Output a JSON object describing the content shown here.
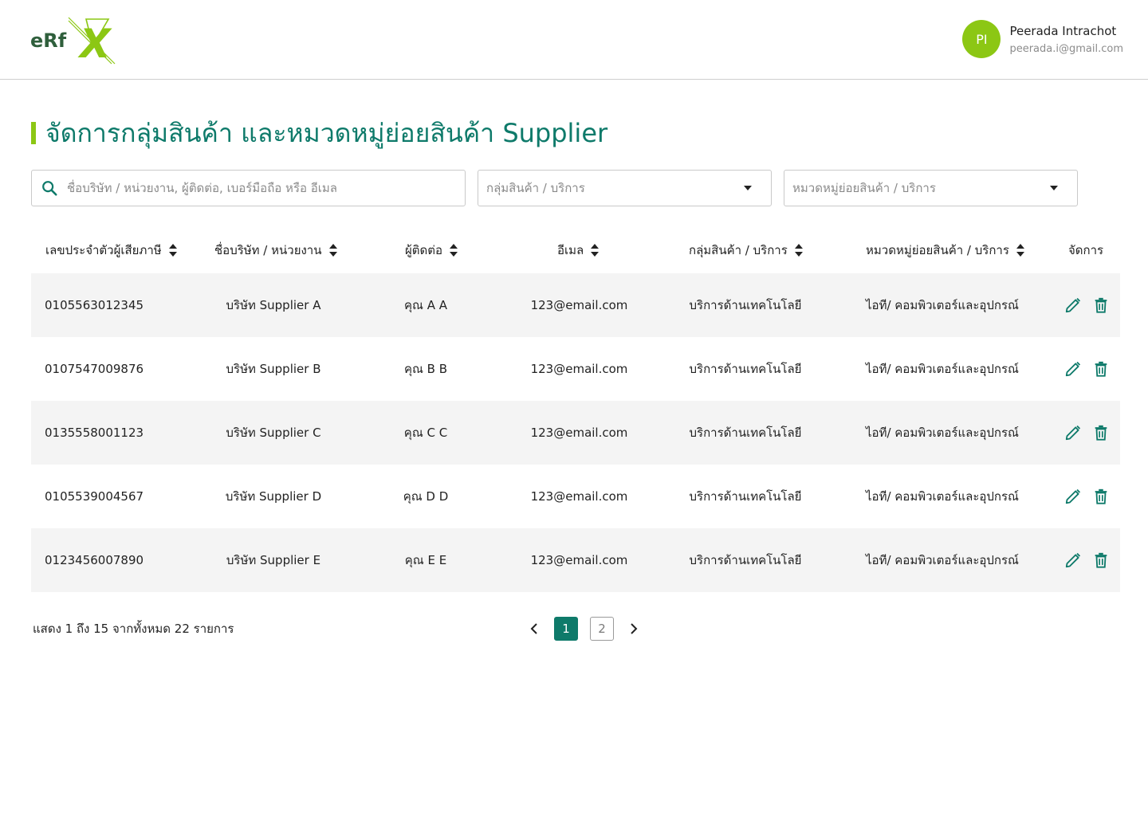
{
  "brand": {
    "logo_text": "eRfX",
    "primary_color": "#0e7a6a",
    "accent_color": "#8cc714"
  },
  "user": {
    "initials": "PI",
    "name": "Peerada Intrachot",
    "email": "peerada.i@gmail.com"
  },
  "page": {
    "title": "จัดการกลุ่มสินค้า และหมวดหมู่ย่อยสินค้า Supplier"
  },
  "filters": {
    "search_placeholder": "ชื่อบริษัท / หน่วยงาน, ผู้ติดต่อ, เบอร์มือถือ หรือ อีเมล",
    "group_placeholder": "กลุ่มสินค้า / บริการ",
    "subcategory_placeholder": "หมวดหมู่ย่อยสินค้า / บริการ"
  },
  "table": {
    "columns": [
      "เลขประจำตัวผู้เสียภาษี",
      "ชื่อบริษัท / หน่วยงาน",
      "ผู้ติดต่อ",
      "อีเมล",
      "กลุ่มสินค้า / บริการ",
      "หมวดหมู่ย่อยสินค้า / บริการ",
      "จัดการ"
    ],
    "rows": [
      {
        "tax_id": "0105563012345",
        "company": "บริษัท Supplier A",
        "contact": "คุณ A A",
        "email": "123@email.com",
        "group": "บริการด้านเทคโนโลยี",
        "subcategory": "ไอที/ คอมพิวเตอร์และอุปกรณ์"
      },
      {
        "tax_id": "0107547009876",
        "company": "บริษัท Supplier B",
        "contact": "คุณ B B",
        "email": "123@email.com",
        "group": "บริการด้านเทคโนโลยี",
        "subcategory": "ไอที/ คอมพิวเตอร์และอุปกรณ์"
      },
      {
        "tax_id": "0135558001123",
        "company": "บริษัท Supplier C",
        "contact": "คุณ C C",
        "email": "123@email.com",
        "group": "บริการด้านเทคโนโลยี",
        "subcategory": "ไอที/ คอมพิวเตอร์และอุปกรณ์"
      },
      {
        "tax_id": "0105539004567",
        "company": "บริษัท Supplier D",
        "contact": "คุณ D D",
        "email": "123@email.com",
        "group": "บริการด้านเทคโนโลยี",
        "subcategory": "ไอที/ คอมพิวเตอร์และอุปกรณ์"
      },
      {
        "tax_id": "0123456007890",
        "company": "บริษัท Supplier E",
        "contact": "คุณ E E",
        "email": "123@email.com",
        "group": "บริการด้านเทคโนโลยี",
        "subcategory": "ไอที/ คอมพิวเตอร์และอุปกรณ์"
      }
    ]
  },
  "pagination": {
    "summary": "แสดง 1 ถึง 15 จากทั้งหมด 22 รายการ",
    "pages": [
      "1",
      "2"
    ],
    "current": "1"
  }
}
